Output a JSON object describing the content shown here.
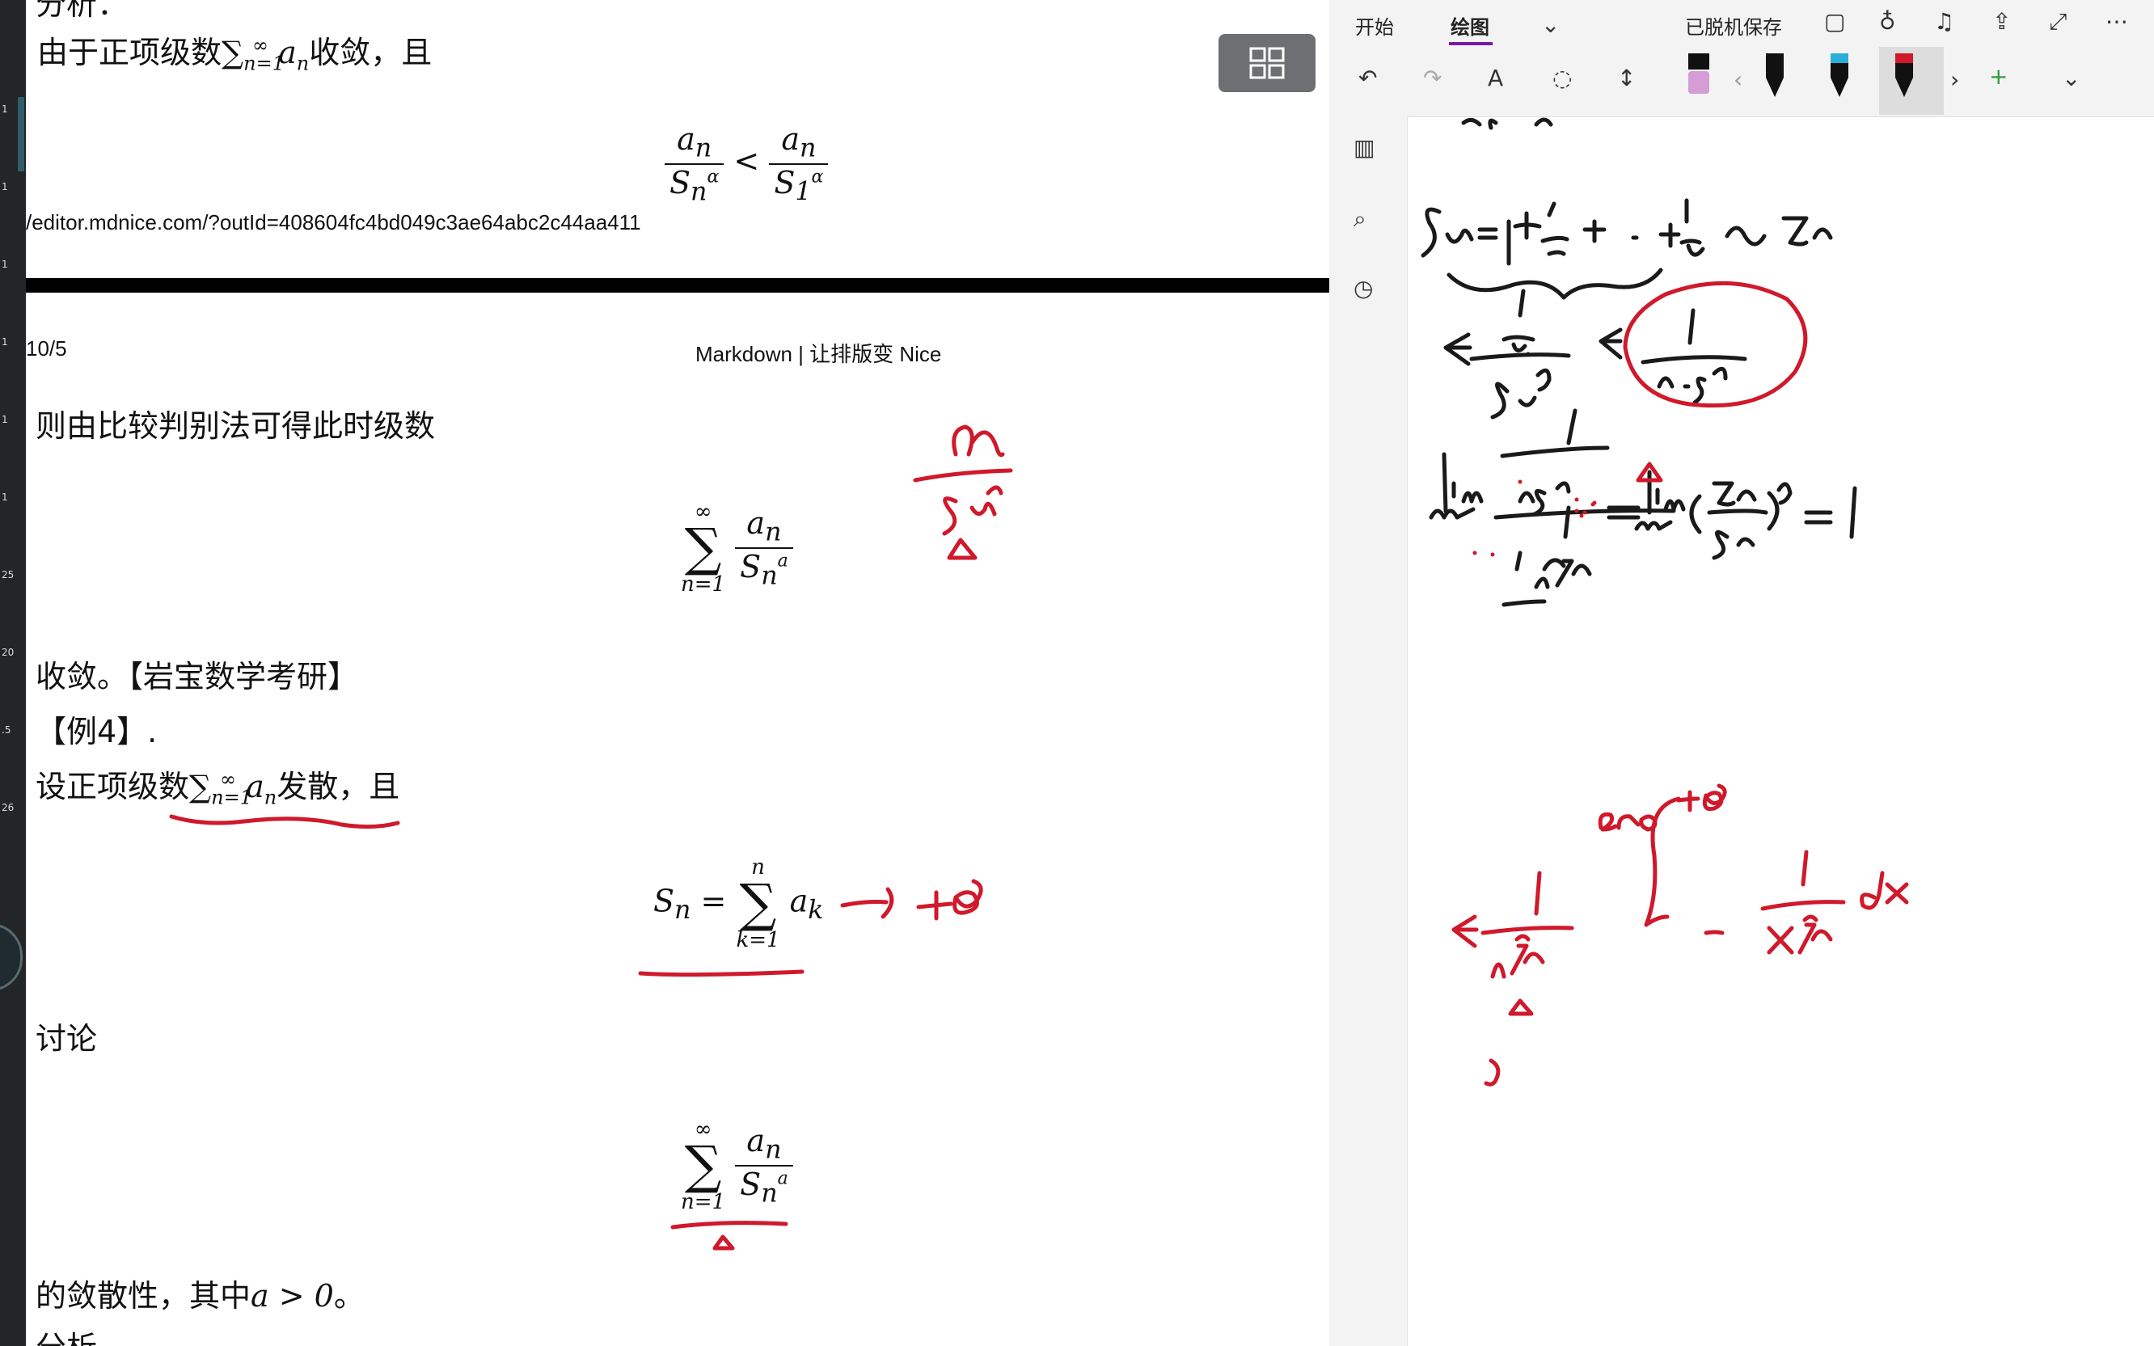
{
  "left_strip": {
    "numbers": [
      "1",
      "1",
      "1",
      "1",
      "1",
      "1",
      "25",
      "20",
      ".5",
      "26"
    ]
  },
  "document": {
    "line1_text": "由于正项级数",
    "line1_after": "收敛，且",
    "url": "/editor.mdnice.com/?outId=408604fc4bd049c3ae64abc2c44aa411",
    "date": "10/5",
    "header_title": "Markdown | 让排版变 Nice",
    "line2": "则由比较判别法可得此时级数",
    "line3": "收敛。【岩宝数学考研】",
    "line4": "【例4】.",
    "line5_text": "设正项级数",
    "line5_after": "发散，且",
    "line6": "讨论",
    "line7_text": "的敛散性，其中",
    "line7_math": "a > 0",
    "line7_end": "。",
    "line8": "分析",
    "line0": "分析："
  },
  "onenote": {
    "tabs": [
      "开始",
      "绘图"
    ],
    "saved": "已脱机保存"
  },
  "colors": {
    "ink_red": "#d0192b",
    "onenote_accent": "#7719aa",
    "toolbar_bg": "#f3f3f3"
  }
}
